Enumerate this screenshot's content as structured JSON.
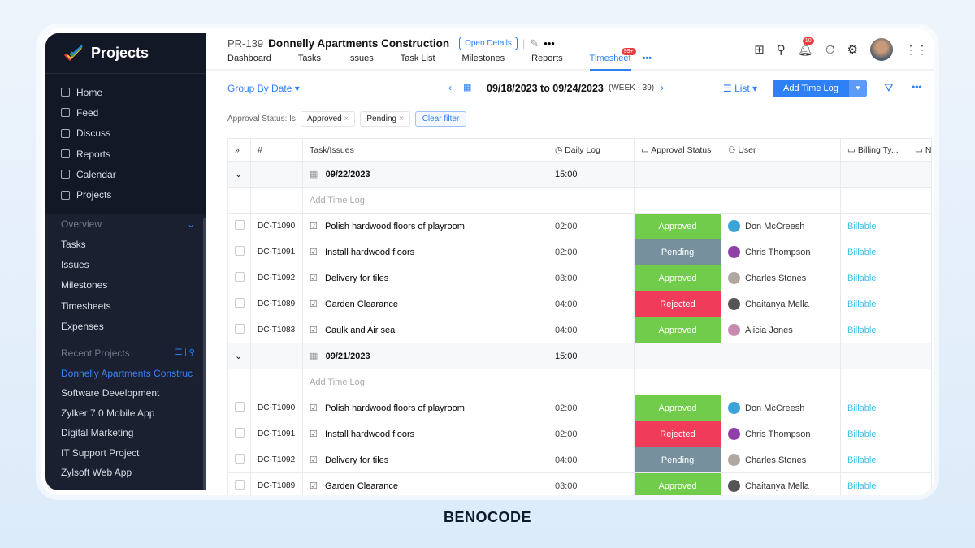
{
  "sidebar": {
    "brand": "Projects",
    "nav": [
      {
        "label": "Home"
      },
      {
        "label": "Feed"
      },
      {
        "label": "Discuss"
      },
      {
        "label": "Reports"
      },
      {
        "label": "Calendar"
      },
      {
        "label": "Projects"
      }
    ],
    "overview_label": "Overview",
    "overview": [
      {
        "label": "Tasks"
      },
      {
        "label": "Issues"
      },
      {
        "label": "Milestones"
      },
      {
        "label": "Timesheets"
      },
      {
        "label": "Expenses"
      }
    ],
    "recent_label": "Recent Projects",
    "recent": [
      {
        "label": "Donnelly Apartments Construc"
      },
      {
        "label": "Software Development"
      },
      {
        "label": "Zylker 7.0 Mobile App"
      },
      {
        "label": "Digital Marketing"
      },
      {
        "label": "IT Support Project"
      },
      {
        "label": "Zylsoft Web App"
      }
    ]
  },
  "header": {
    "project_id": "PR-139",
    "project_name": "Donnelly Apartments Construction",
    "open_details": "Open Details",
    "tabs": [
      {
        "label": "Dashboard"
      },
      {
        "label": "Tasks"
      },
      {
        "label": "Issues"
      },
      {
        "label": "Task List"
      },
      {
        "label": "Milestones"
      },
      {
        "label": "Reports"
      },
      {
        "label": "Timesheet"
      }
    ],
    "timesheet_badge": "99+",
    "notif_badge": "10"
  },
  "toolbar": {
    "group_by": "Group By Date",
    "date_range": "09/18/2023 to 09/24/2023",
    "week": "(WEEK - 39)",
    "view": "List",
    "add_time_log": "Add Time Log"
  },
  "filter": {
    "label": "Approval Status: Is",
    "chips": [
      "Approved",
      "Pending"
    ],
    "clear": "Clear filter"
  },
  "table": {
    "columns": [
      "#",
      "Task/Issues",
      "Daily Log",
      "Approval Status",
      "User",
      "Billing Ty...",
      "N"
    ],
    "add_label": "Add Time Log",
    "groups": [
      {
        "date": "09/22/2023",
        "total": "15:00",
        "rows": [
          {
            "id": "DC-T1090",
            "task": "Polish hardwood floors of playroom",
            "log": "02:00",
            "status": "Approved",
            "user": "Don McCreesh",
            "billing": "Billable"
          },
          {
            "id": "DC-T1091",
            "task": "Install hardwood floors",
            "log": "02:00",
            "status": "Pending",
            "user": "Chris Thompson",
            "billing": "Billable"
          },
          {
            "id": "DC-T1092",
            "task": "Delivery for tiles",
            "log": "03:00",
            "status": "Approved",
            "user": "Charles Stones",
            "billing": "Billable"
          },
          {
            "id": "DC-T1089",
            "task": "Garden Clearance",
            "log": "04:00",
            "status": "Rejected",
            "user": "Chaitanya Mella",
            "billing": "Billable"
          },
          {
            "id": "DC-T1083",
            "task": "Caulk and Air seal",
            "log": "04:00",
            "status": "Approved",
            "user": "Alicia Jones",
            "billing": "Billable"
          }
        ]
      },
      {
        "date": "09/21/2023",
        "total": "15:00",
        "rows": [
          {
            "id": "DC-T1090",
            "task": "Polish hardwood floors of playroom",
            "log": "02:00",
            "status": "Approved",
            "user": "Don McCreesh",
            "billing": "Billable"
          },
          {
            "id": "DC-T1091",
            "task": "Install hardwood floors",
            "log": "02:00",
            "status": "Rejected",
            "user": "Chris Thompson",
            "billing": "Billable"
          },
          {
            "id": "DC-T1092",
            "task": "Delivery for tiles",
            "log": "04:00",
            "status": "Pending",
            "user": "Charles Stones",
            "billing": "Billable"
          },
          {
            "id": "DC-T1089",
            "task": "Garden Clearance",
            "log": "03:00",
            "status": "Approved",
            "user": "Chaitanya Mella",
            "billing": "Billable"
          }
        ]
      }
    ]
  },
  "footer": {
    "brand": "BENOCODE"
  },
  "colors": {
    "accent": "#2f7ff5",
    "approved": "#72cc4b",
    "pending": "#77909e",
    "rejected": "#f03c5a"
  }
}
